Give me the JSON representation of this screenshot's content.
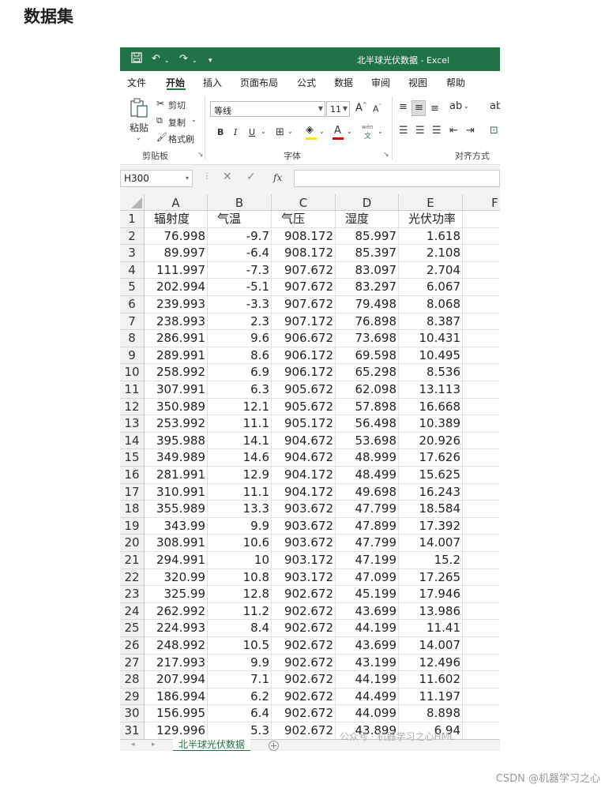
{
  "page": {
    "heading": "数据集",
    "footer": "CSDN @机器学习之心",
    "watermark": "公众号 · 机器学习之心HML"
  },
  "window": {
    "title": "北半球光伏数据 - Excel",
    "accent": "#217346"
  },
  "quick_access": {
    "icons": [
      "save-icon",
      "undo-icon",
      "redo-icon",
      "customize-icon"
    ]
  },
  "menu": {
    "tabs": [
      {
        "label": "文件"
      },
      {
        "label": "开始",
        "active": true
      },
      {
        "label": "插入"
      },
      {
        "label": "页面布局"
      },
      {
        "label": "公式"
      },
      {
        "label": "数据"
      },
      {
        "label": "审阅"
      },
      {
        "label": "视图"
      },
      {
        "label": "帮助"
      }
    ]
  },
  "ribbon": {
    "clipboard": {
      "paste": "粘贴",
      "cut": "剪切",
      "copy": "复制",
      "format_painter": "格式刷",
      "group_label": "剪贴板"
    },
    "font": {
      "font_name": "等线",
      "font_size": "11",
      "bold": "B",
      "italic": "I",
      "underline": "U",
      "font_color_glyph": "A",
      "phonetic_glyph": "wén",
      "grow_glyph": "A",
      "shrink_glyph": "A",
      "group_label": "字体"
    },
    "alignment": {
      "group_label": "对齐方式"
    }
  },
  "formula_bar": {
    "name_box": "H300",
    "fx": "fx",
    "value": ""
  },
  "sheet": {
    "columns": [
      "A",
      "B",
      "C",
      "D",
      "E",
      "F"
    ],
    "headers": [
      "辐射度",
      "气温",
      "气压",
      "湿度",
      "光伏功率"
    ],
    "rows": [
      [
        "76.998",
        "-9.7",
        "908.172",
        "85.997",
        "1.618"
      ],
      [
        "89.997",
        "-6.4",
        "908.172",
        "85.397",
        "2.108"
      ],
      [
        "111.997",
        "-7.3",
        "907.672",
        "83.097",
        "2.704"
      ],
      [
        "202.994",
        "-5.1",
        "907.672",
        "83.297",
        "6.067"
      ],
      [
        "239.993",
        "-3.3",
        "907.672",
        "79.498",
        "8.068"
      ],
      [
        "238.993",
        "2.3",
        "907.172",
        "76.898",
        "8.387"
      ],
      [
        "286.991",
        "9.6",
        "906.672",
        "73.698",
        "10.431"
      ],
      [
        "289.991",
        "8.6",
        "906.172",
        "69.598",
        "10.495"
      ],
      [
        "258.992",
        "6.9",
        "906.172",
        "65.298",
        "8.536"
      ],
      [
        "307.991",
        "6.3",
        "905.672",
        "62.098",
        "13.113"
      ],
      [
        "350.989",
        "12.1",
        "905.672",
        "57.898",
        "16.668"
      ],
      [
        "253.992",
        "11.1",
        "905.172",
        "56.498",
        "10.389"
      ],
      [
        "395.988",
        "14.1",
        "904.672",
        "53.698",
        "20.926"
      ],
      [
        "349.989",
        "14.6",
        "904.672",
        "48.999",
        "17.626"
      ],
      [
        "281.991",
        "12.9",
        "904.172",
        "48.499",
        "15.625"
      ],
      [
        "310.991",
        "11.1",
        "904.172",
        "49.698",
        "16.243"
      ],
      [
        "355.989",
        "13.3",
        "903.672",
        "47.799",
        "18.584"
      ],
      [
        "343.99",
        "9.9",
        "903.672",
        "47.899",
        "17.392"
      ],
      [
        "308.991",
        "10.6",
        "903.672",
        "47.799",
        "14.007"
      ],
      [
        "294.991",
        "10",
        "903.172",
        "47.199",
        "15.2"
      ],
      [
        "320.99",
        "10.8",
        "903.172",
        "47.099",
        "17.265"
      ],
      [
        "325.99",
        "12.8",
        "902.672",
        "45.199",
        "17.946"
      ],
      [
        "262.992",
        "11.2",
        "902.672",
        "43.699",
        "13.986"
      ],
      [
        "224.993",
        "8.4",
        "902.672",
        "44.199",
        "11.41"
      ],
      [
        "248.992",
        "10.5",
        "902.672",
        "43.699",
        "14.007"
      ],
      [
        "217.993",
        "9.9",
        "902.672",
        "43.199",
        "12.496"
      ],
      [
        "207.994",
        "7.1",
        "902.672",
        "44.199",
        "11.602"
      ],
      [
        "186.994",
        "6.2",
        "902.672",
        "44.499",
        "11.197"
      ],
      [
        "156.995",
        "6.4",
        "902.672",
        "44.099",
        "8.898"
      ],
      [
        "129.996",
        "5.3",
        "902.672",
        "43.899",
        "6.94"
      ]
    ]
  },
  "sheet_tabs": {
    "active": "北半球光伏数据",
    "add": "+"
  }
}
